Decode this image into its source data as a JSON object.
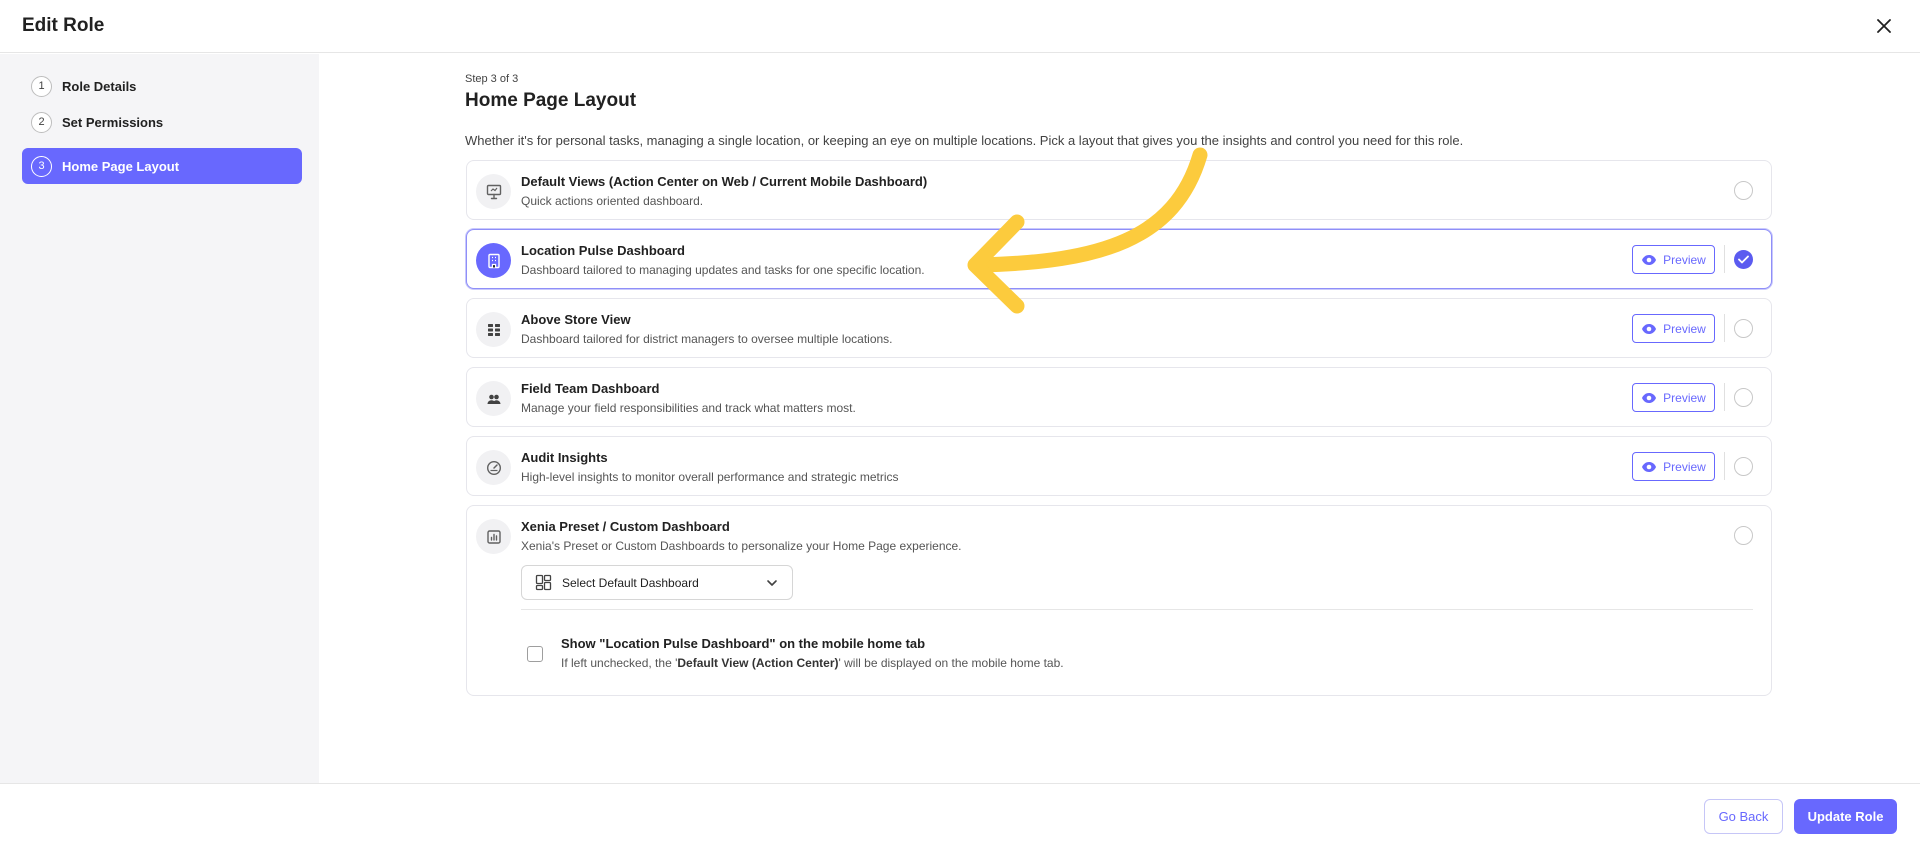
{
  "header": {
    "title": "Edit Role",
    "close_icon": "close-icon"
  },
  "sidebar": {
    "steps": [
      {
        "num": "1",
        "label": "Role Details"
      },
      {
        "num": "2",
        "label": "Set Permissions"
      },
      {
        "num": "3",
        "label": "Home Page Layout",
        "active": true
      }
    ]
  },
  "main": {
    "step_count": "Step 3 of 3",
    "title": "Home Page Layout",
    "description": "Whether it's for personal tasks, managing a single location, or keeping an eye on multiple locations. Pick a layout that gives you the insights and control you need for this role.",
    "preview_label": "Preview",
    "options": [
      {
        "title": "Default Views (Action Center on Web / Current Mobile Dashboard)",
        "subtitle": "Quick actions oriented dashboard.",
        "icon": "presentation-board-icon",
        "selected": false
      },
      {
        "title": "Location Pulse Dashboard",
        "subtitle": "Dashboard tailored to managing updates and tasks for one specific location.",
        "icon": "building-icon",
        "selected": true
      },
      {
        "title": "Above Store View",
        "subtitle": "Dashboard tailored for district managers to oversee multiple locations.",
        "icon": "grid-icon",
        "selected": false
      },
      {
        "title": "Field Team Dashboard",
        "subtitle": "Manage your field responsibilities and track what matters most.",
        "icon": "team-icon",
        "selected": false
      },
      {
        "title": "Audit Insights",
        "subtitle": "High-level insights to monitor overall performance and strategic metrics",
        "icon": "gauge-icon",
        "selected": false
      },
      {
        "title": "Xenia Preset / Custom Dashboard",
        "subtitle": "Xenia's Preset or Custom Dashboards to personalize your Home Page experience.",
        "icon": "chart-icon",
        "selected": false
      }
    ],
    "custom": {
      "select_placeholder": "Select Default Dashboard",
      "mobile_checkbox_label": "Show \"Location Pulse Dashboard\" on the mobile home tab",
      "mobile_checkbox_hint_prefix": "If left unchecked, the '",
      "mobile_checkbox_hint_bold": "Default View (Action Center)",
      "mobile_checkbox_hint_suffix": "' will be displayed on the mobile home tab.",
      "mobile_checked": false
    }
  },
  "footer": {
    "back_label": "Go Back",
    "update_label": "Update Role"
  },
  "colors": {
    "accent": "#6868fe",
    "annotation_arrow": "#fccb3d"
  }
}
